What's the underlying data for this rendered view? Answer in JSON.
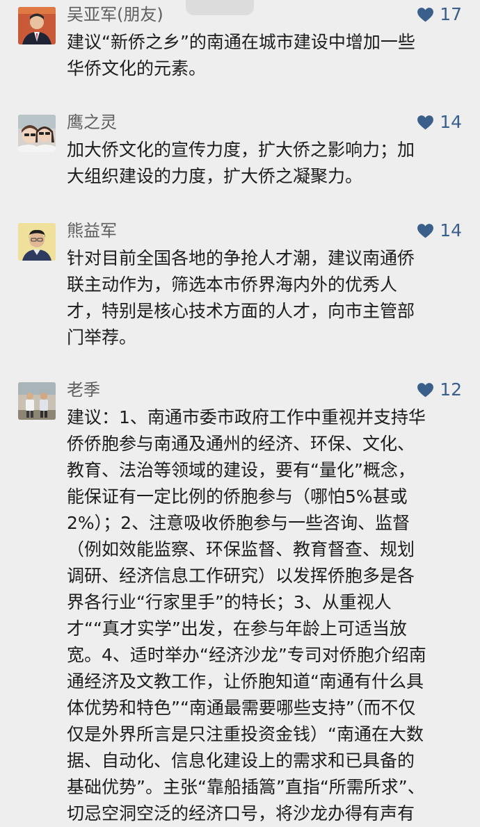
{
  "comments": [
    {
      "name": "吴亚军(朋友)",
      "likes": "17",
      "text": "建议“新侨之乡”的南通在城市建设中增加一些\n华侨文化的元素。"
    },
    {
      "name": "鹰之灵",
      "likes": "14",
      "text": "加大侨文化的宣传力度，扩大侨之影响力；加\n大组织建设的力度，扩大侨之凝聚力。"
    },
    {
      "name": "熊益军",
      "likes": "14",
      "text": "针对目前全国各地的争抢人才潮，建议南通侨\n联主动作为，筛选本市侨界海内外的优秀人\n才，特别是核心技术方面的人才，向市主管部\n门举荐。"
    },
    {
      "name": "老季",
      "likes": "12",
      "text": "建议：1、南通市委市政府工作中重视并支持华\n侨侨胞参与南通及通州的经济、环保、文化、\n教育、法治等领域的建设，要有“量化”概念，\n能保证有一定比例的侨胞参与（哪怕5%甚或\n2%）；2、注意吸收侨胞参与一些咨询、监督\n（例如效能监察、环保监督、教育督查、规划\n调研、经济信息工作研究）以发挥侨胞多是各\n界各行业“行家里手”的特长；3、从重视人\n才““真才实学”出发，在参与年龄上可适当放\n宽。4、适时举办“经济沙龙”专司对侨胞介绍南\n通经济及文教工作，让侨胞知道“南通有什么具\n体优势和特色”“南通最需要哪些支持”（而不仅\n仅是外界所言是只注重投资金钱）“南通在大数\n据、自动化、信息化建设上的需求和已具备的\n基础优势”。主张“靠船插篙”直指“所需所求”、\n切忌空洞空泛的经济口号，将沙龙办得有声有"
    }
  ],
  "colors": {
    "background": "#eeeeee",
    "name": "#5e5e5e",
    "like_accent": "#3a5f8a",
    "text": "#1c1c1c"
  }
}
